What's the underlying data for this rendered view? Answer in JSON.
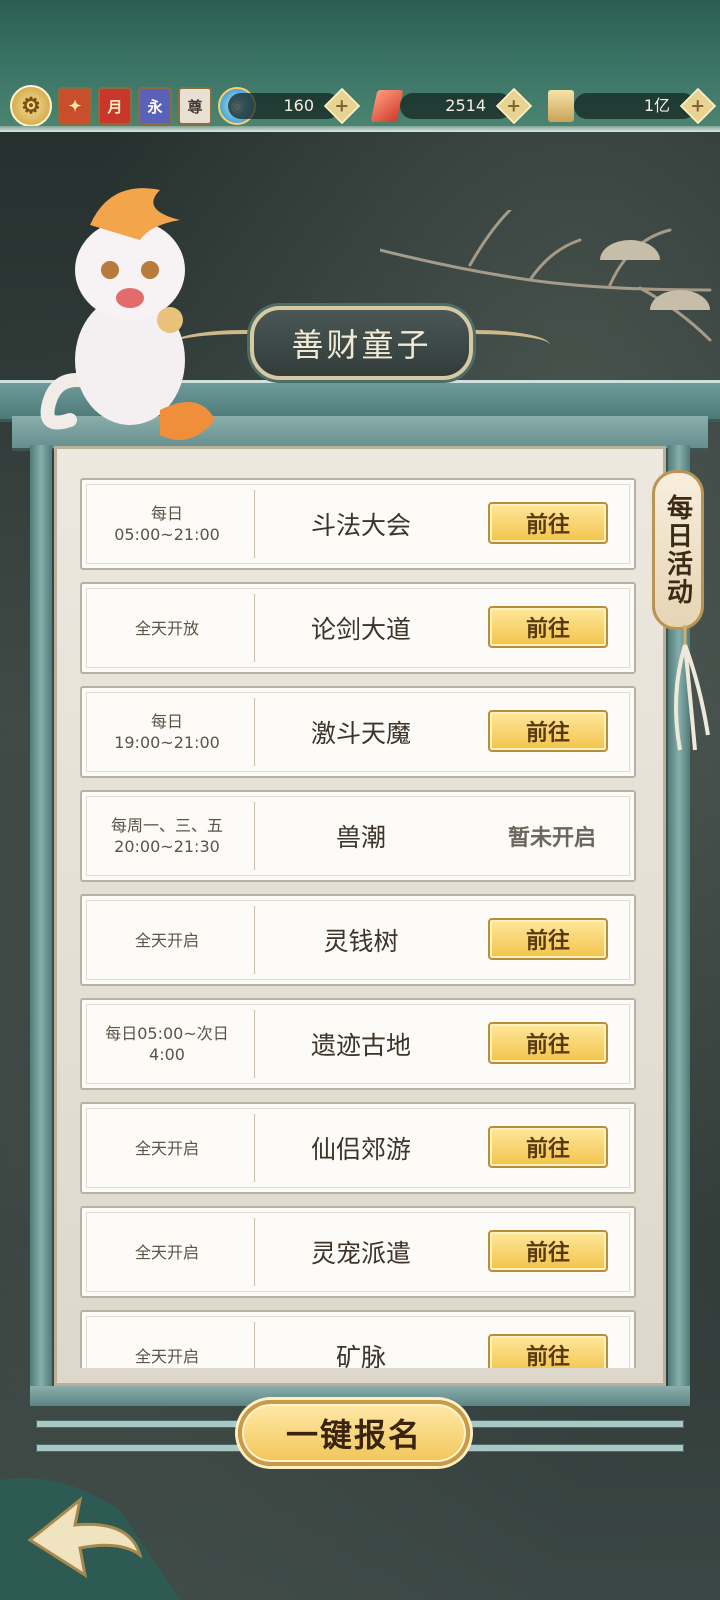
{
  "currency": {
    "jade": "160",
    "gem": "2514",
    "silver": "1亿"
  },
  "badges": {
    "moon": "月",
    "forever": "永",
    "honor": "尊"
  },
  "title": "善财童子",
  "side_tab": "每日活动",
  "activities": [
    {
      "time": "每日\n05:00~21:00",
      "name": "斗法大会",
      "action": "前往"
    },
    {
      "time": "全天开放",
      "name": "论剑大道",
      "action": "前往"
    },
    {
      "time": "每日\n19:00~21:00",
      "name": "激斗天魔",
      "action": "前往"
    },
    {
      "time": "每周一、三、五\n20:00~21:30",
      "name": "兽潮",
      "status": "暂未开启"
    },
    {
      "time": "全天开启",
      "name": "灵钱树",
      "action": "前往"
    },
    {
      "time": "每日05:00~次日\n4:00",
      "name": "遗迹古地",
      "action": "前往"
    },
    {
      "time": "全天开启",
      "name": "仙侣郊游",
      "action": "前往"
    },
    {
      "time": "全天开启",
      "name": "灵宠派遣",
      "action": "前往"
    },
    {
      "time": "全天开启",
      "name": "矿脉",
      "action": "前往"
    }
  ],
  "signup_button": "一键报名",
  "colors": {
    "topbar": "#3b7466",
    "button_gold": "#f2c34b",
    "panel": "#ece8df"
  },
  "icons": [
    "gear-icon",
    "amulet-icon",
    "moon-card-icon",
    "forever-card-icon",
    "honor-card-icon",
    "jade-icon",
    "gem-icon",
    "scroll-icon",
    "back-arrow-icon"
  ]
}
